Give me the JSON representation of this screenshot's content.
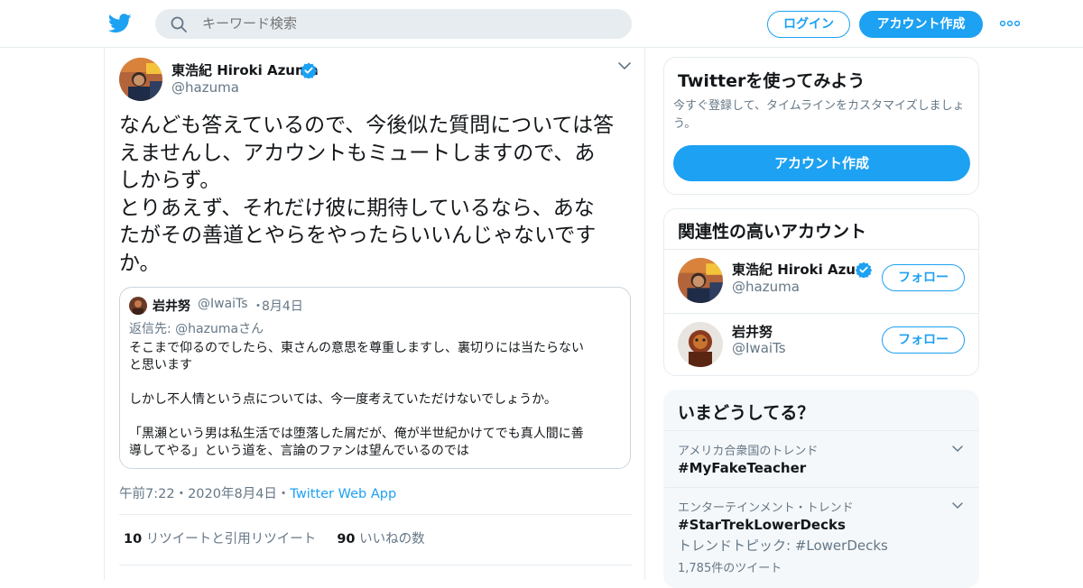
{
  "header": {
    "search_placeholder": "キーワード検索",
    "login_label": "ログイン",
    "signup_label": "アカウント作成"
  },
  "tweet": {
    "author_name": "東浩紀 Hiroki Azuma",
    "author_handle": "@hazuma",
    "text": "なんども答えているので、今後似た質問については答\nえませんし、アカウントもミュートしますので、あ\nしからず。\nとりあえず、それだけ彼に期待しているなら、あな\nたがその善道とやらをやったらいいんじゃないです\nか。",
    "quote": {
      "name": "岩井努",
      "handle": "@IwaiTs",
      "dot": "・",
      "date": "8月4日",
      "reply_prefix": "返信先: ",
      "reply_to": "@hazumaさん",
      "text": "そこまで仰るのでしたら、東さんの意思を尊重しますし、裏切りには当たらない\nと思います\n\nしかし不人情という点については、今一度考えていただけないでしょうか。\n\n「黒瀬という男は私生活では堕落した屑だが、俺が半世紀かけてでも真人間に善\n導してやる」という道を、言論のファンは望んでいるのでは"
    },
    "time": "午前7:22",
    "sep1": "・",
    "date": "2020年8月4日",
    "sep2": "・",
    "source": "Twitter Web App",
    "retweets_count": "10",
    "retweets_label": "リツイートと引用リツイート",
    "likes_count": "90",
    "likes_label": "いいねの数"
  },
  "sidebar": {
    "promo": {
      "title": "Twitterを使ってみよう",
      "subtitle": "今すぐ登録して、タイムラインをカスタマイズしましょう。",
      "button": "アカウント作成"
    },
    "related": {
      "title": "関連性の高いアカウント",
      "accounts": [
        {
          "name": "東浩紀 Hiroki Azu...",
          "handle": "@hazuma",
          "follow": "フォロー"
        },
        {
          "name": "岩井努",
          "handle": "@IwaiTs",
          "follow": "フォロー"
        }
      ]
    },
    "trends": {
      "title": "いまどうしてる？",
      "items": [
        {
          "context": "アメリカ合衆国のトレンド",
          "tag": "#MyFakeTeacher"
        },
        {
          "context": "エンターテインメント・トレンド",
          "tag": "#StarTrekLowerDecks",
          "topic": "トレンドトピック: #LowerDecks",
          "count": "1,785件のツイート"
        }
      ]
    }
  },
  "colors": {
    "accent": "#1da1f2",
    "text": "#14171a",
    "muted": "#657786",
    "border": "#e6ecf0"
  }
}
